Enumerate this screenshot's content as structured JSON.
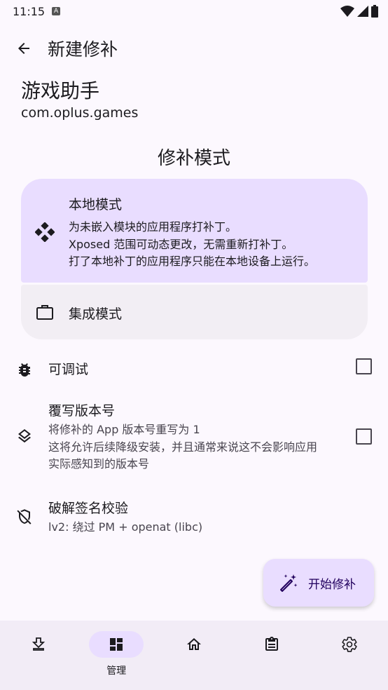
{
  "status": {
    "time": "11:15",
    "badge": "A"
  },
  "header": {
    "title": "新建修补"
  },
  "app": {
    "name": "游戏助手",
    "package": "com.oplus.games"
  },
  "patch_mode": {
    "title": "修补模式",
    "local": {
      "label": "本地模式",
      "desc": [
        "为未嵌入模块的应用程序打补丁。",
        "Xposed 范围可动态更改，无需重新打补丁。",
        "打了本地补丁的应用程序只能在本地设备上运行。"
      ]
    },
    "integrated": {
      "label": "集成模式"
    }
  },
  "options": {
    "debuggable": {
      "label": "可调试"
    },
    "override_version": {
      "label": "覆写版本号",
      "desc": [
        "将修补的 App 版本号重写为 1",
        "这将允许后续降级安装，并且通常来说这不会影响应用",
        "实际感知到的版本号"
      ]
    },
    "sig_bypass": {
      "label": "破解签名校验",
      "value": "lv2: 绕过 PM + openat (libc)"
    }
  },
  "fab": {
    "label": "开始修补"
  },
  "nav": {
    "manage_label": "管理"
  },
  "colors": {
    "accent": "#e9ddff",
    "background": "#fcf8fe",
    "nav_bg": "#f2ecf6"
  }
}
